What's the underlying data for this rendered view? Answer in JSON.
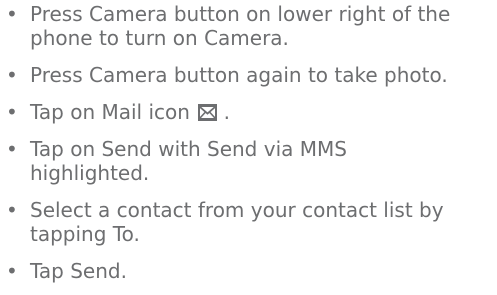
{
  "bullet_char": "•",
  "steps": [
    {
      "text": "Press Camera button on lower right of the phone to turn on Camera."
    },
    {
      "text": "Press Camera button again to take photo."
    },
    {
      "text_before": "Tap on Mail icon",
      "icon": "mail-icon",
      "text_after": "."
    },
    {
      "text": "Tap on Send with Send via MMS highlighted."
    },
    {
      "text": "Select a contact from your contact list by tapping To."
    },
    {
      "text": "Tap Send."
    }
  ],
  "colors": {
    "text": "#6d6e70",
    "icon": "#6d6e70"
  }
}
